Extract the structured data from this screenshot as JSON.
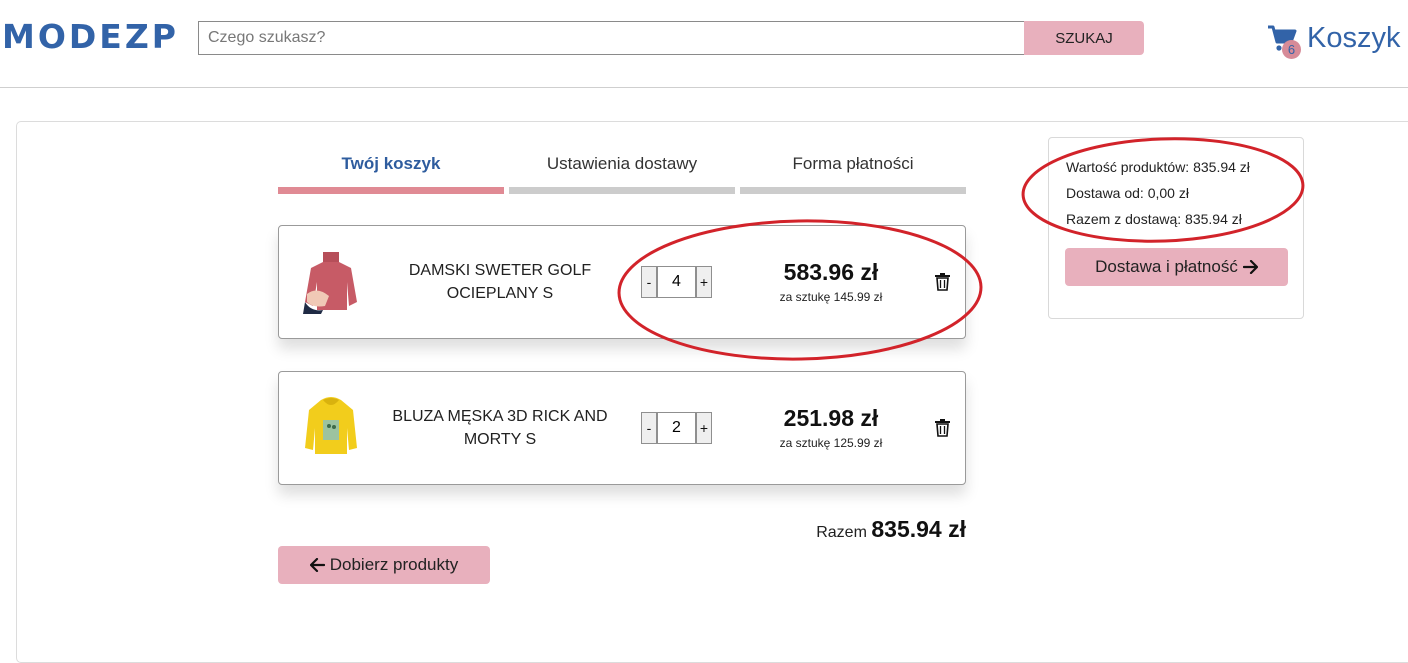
{
  "header": {
    "logo": "MODEZP",
    "search_placeholder": "Czego szukasz?",
    "search_button": "SZUKAJ",
    "cart_count": "6",
    "cart_label": "Koszyk"
  },
  "steps": [
    {
      "label": "Twój koszyk",
      "active": true
    },
    {
      "label": "Ustawienia dostawy",
      "active": false
    },
    {
      "label": "Forma płatności",
      "active": false
    }
  ],
  "items": [
    {
      "name": "DAMSKI SWETER GOLF OCIEPLANY S",
      "quantity": "4",
      "price_total": "583.96 zł",
      "price_unit": "za sztukę 145.99 zł",
      "image": "pink-sweater",
      "minus": "-",
      "plus": "+"
    },
    {
      "name": "BLUZA MĘSKA 3D RICK AND MORTY S",
      "quantity": "2",
      "price_total": "251.98 zł",
      "price_unit": "za sztukę 125.99 zł",
      "image": "yellow-hoodie",
      "minus": "-",
      "plus": "+"
    }
  ],
  "total": {
    "label": "Razem",
    "value": "835.94 zł"
  },
  "back_button": "Dobierz produkty",
  "summary": {
    "products_value": "Wartość produktów: 835.94 zł",
    "delivery_from": "Dostawa od: 0,00 zł",
    "total_with_delivery": "Razem z dostawą: 835.94 zł",
    "checkout_button": "Dostawa i płatność"
  },
  "colors": {
    "brand_blue": "#3263a8",
    "button_pink": "#e8b0bd",
    "active_step": "#e08a94",
    "annotation_red": "#d2232a"
  }
}
